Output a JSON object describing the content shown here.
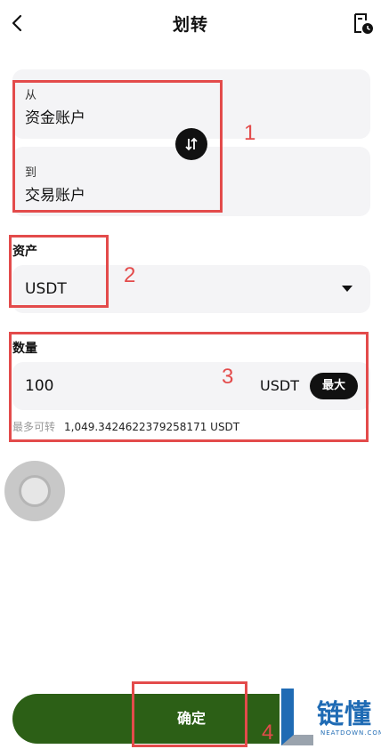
{
  "header": {
    "title": "划转"
  },
  "transfer": {
    "from_label": "从",
    "from_account": "资金账户",
    "to_label": "到",
    "to_account": "交易账户"
  },
  "asset": {
    "label": "资产",
    "value": "USDT"
  },
  "amount": {
    "label": "数量",
    "value": "100",
    "unit": "USDT",
    "max_label": "最大",
    "available_label": "最多可转",
    "available_value": "1,049.3424622379258171 USDT"
  },
  "confirm_label": "确定",
  "annotations": [
    "1",
    "2",
    "3",
    "4"
  ],
  "watermark": {
    "cn": "链懂",
    "en": "NEATDOWN.COM"
  },
  "colors": {
    "accent_button": "#2c5f16",
    "annotation": "#e34b4b",
    "input_bg": "#f4f4f6",
    "watermark": "#1f6bb4"
  }
}
